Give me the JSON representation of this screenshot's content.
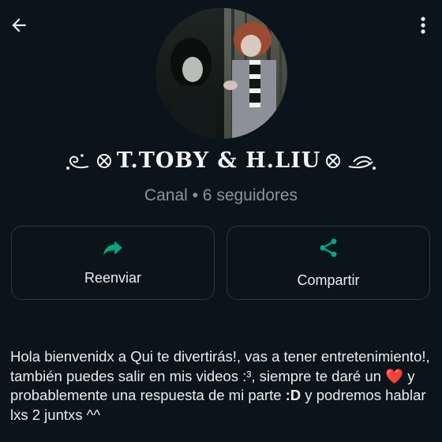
{
  "header": {
    "back_icon": "arrow-left-icon",
    "menu_icon": "more-vertical-icon"
  },
  "channel": {
    "name": "T.TOBY & H.LIU",
    "meta": "Canal • 6 seguidores",
    "avatar_alt": "channel-avatar"
  },
  "actions": [
    {
      "label": "Reenviar",
      "icon": "forward-icon"
    },
    {
      "label": "Compartir",
      "icon": "share-icon"
    }
  ],
  "description": {
    "part1": "Hola bienvenidx a Qui te divertirás!, vas a tener entretenimiento!, también puedes salir en mis videos :³, siempre te daré un ",
    "heart": "❤️",
    "part2": " y probablemente una respuesta de mi parte ",
    "bold": ":D",
    "part3": " y podremos hablar lxs 2 juntxs ^^"
  },
  "colors": {
    "background": "#0b141a",
    "accent": "#00a884",
    "muted_text": "#8696a0",
    "border": "#2a3942"
  }
}
